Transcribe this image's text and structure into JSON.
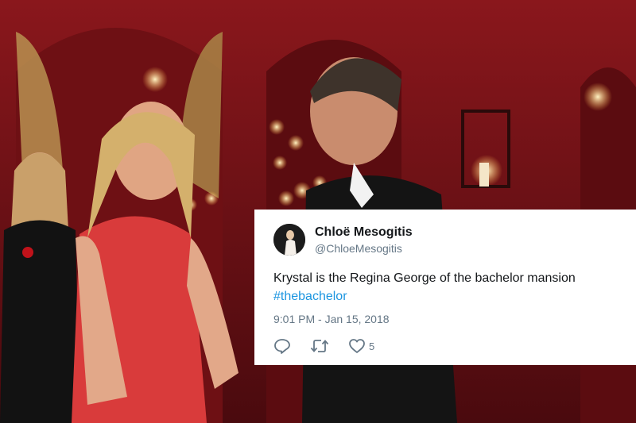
{
  "tweet": {
    "display_name": "Chloë Mesogitis",
    "handle": "@ChloeMesogitis",
    "text": "Krystal is the Regina George of the bachelor mansion",
    "hashtag": "#thebachelor",
    "timestamp": "9:01 PM - Jan 15, 2018",
    "likes": "5"
  },
  "icons": {
    "reply": "reply-icon",
    "retweet": "retweet-icon",
    "like": "heart-icon"
  },
  "colors": {
    "link": "#1b95e0",
    "secondary_text": "#657786",
    "primary_text": "#14171a",
    "scene_red": "#8e1a1f"
  }
}
